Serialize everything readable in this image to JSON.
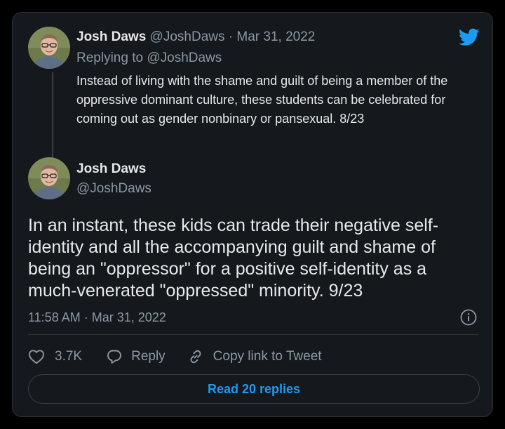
{
  "colors": {
    "card_background": "#15181c",
    "text_primary": "#e7e9ea",
    "text_secondary": "#8b98a5",
    "accent": "#1d9bf0",
    "border": "#2f3336"
  },
  "icons": {
    "brand": "twitter-bird-icon",
    "info": "info-icon",
    "like": "heart-icon",
    "reply": "speech-bubble-icon",
    "copy_link": "link-icon"
  },
  "quoted_tweet": {
    "author_name": "Josh Daws",
    "author_handle": "@JoshDaws",
    "separator": "·",
    "date": "Mar 31, 2022",
    "replying_prefix": "Replying to",
    "replying_to": "@JoshDaws",
    "text": "Instead of living with the shame and guilt of being a member of the oppressive dominant culture, these students can be celebrated for coming out as gender nonbinary or pansexual. 8/23"
  },
  "main_tweet": {
    "author_name": "Josh Daws",
    "author_handle": "@JoshDaws",
    "text": "In an instant, these kids can trade their negative self-identity and all the accompanying guilt and shame of being an \"oppressor\" for a positive self-identity as a much-venerated \"oppressed\" minority. 9/23",
    "time": "11:58 AM",
    "separator": "·",
    "date": "Mar 31, 2022"
  },
  "actions": {
    "like_count": "3.7K",
    "reply_label": "Reply",
    "copy_link_label": "Copy link to Tweet"
  },
  "read_replies_label": "Read 20 replies"
}
